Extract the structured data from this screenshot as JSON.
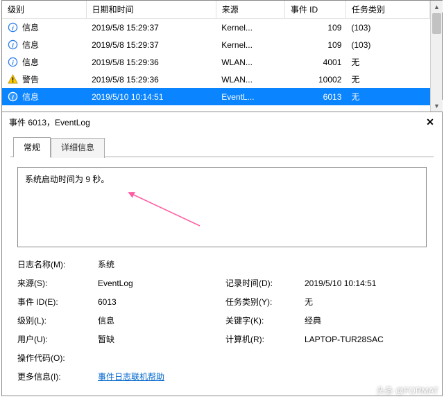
{
  "columns": {
    "level": "级别",
    "datetime": "日期和时间",
    "source": "来源",
    "eventid": "事件 ID",
    "category": "任务类别"
  },
  "rows": [
    {
      "icon": "info",
      "level": "信息",
      "datetime": "2019/5/8 15:29:37",
      "source": "Kernel...",
      "eventid": "109",
      "category": "(103)"
    },
    {
      "icon": "info",
      "level": "信息",
      "datetime": "2019/5/8 15:29:37",
      "source": "Kernel...",
      "eventid": "109",
      "category": "(103)"
    },
    {
      "icon": "info",
      "level": "信息",
      "datetime": "2019/5/8 15:29:36",
      "source": "WLAN...",
      "eventid": "4001",
      "category": "无"
    },
    {
      "icon": "warn",
      "level": "警告",
      "datetime": "2019/5/8 15:29:36",
      "source": "WLAN...",
      "eventid": "10002",
      "category": "无"
    },
    {
      "icon": "info",
      "level": "信息",
      "datetime": "2019/5/10 10:14:51",
      "source": "EventL...",
      "eventid": "6013",
      "category": "无",
      "selected": true
    }
  ],
  "details": {
    "title": "事件 6013，EventLog",
    "tabs": {
      "general": "常规",
      "details": "详细信息"
    },
    "message": "系统启动时间为 9 秒。",
    "labels": {
      "logname": "日志名称(M):",
      "source": "来源(S):",
      "eventid": "事件 ID(E):",
      "level": "级别(L):",
      "user": "用户(U):",
      "opcode": "操作代码(O):",
      "moreinfo": "更多信息(I):",
      "logged": "记录时间(D):",
      "taskcat": "任务类别(Y):",
      "keywords": "关键字(K):",
      "computer": "计算机(R):"
    },
    "values": {
      "logname": "系统",
      "source": "EventLog",
      "eventid": "6013",
      "level": "信息",
      "user": "暂缺",
      "opcode": "",
      "moreinfo": "事件日志联机帮助",
      "logged": "2019/5/10 10:14:51",
      "taskcat": "无",
      "keywords": "经典",
      "computer": "LAPTOP-TUR28SAC"
    }
  },
  "watermark": "头条 @FORMAT"
}
